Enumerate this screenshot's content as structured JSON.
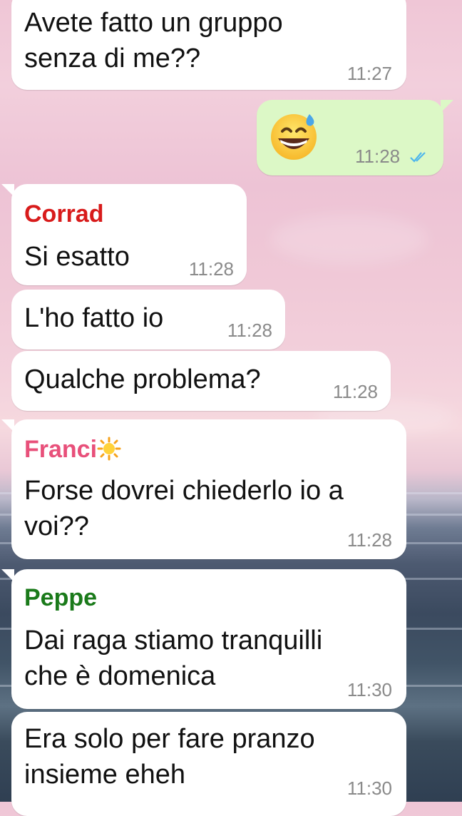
{
  "colors": {
    "incoming_bubble": "#ffffff",
    "outgoing_bubble": "#dcf8c6",
    "read_ticks": "#4fb6ec",
    "sender_corrad": "#d81b1b",
    "sender_franci": "#e8507a",
    "sender_peppe": "#1a7a1a"
  },
  "messages": [
    {
      "type": "incoming",
      "lines": [
        "Avete fatto un gruppo",
        "senza di me??"
      ],
      "time": "11:27"
    },
    {
      "type": "outgoing",
      "emoji": "grinning-face-with-sweat",
      "time": "11:28",
      "status": "read"
    },
    {
      "type": "incoming",
      "sender": "Corrad",
      "lines": [
        "Si esatto"
      ],
      "time": "11:28"
    },
    {
      "type": "incoming",
      "lines": [
        "L'ho fatto io"
      ],
      "time": "11:28"
    },
    {
      "type": "incoming",
      "lines": [
        "Qualche problema?"
      ],
      "time": "11:28"
    },
    {
      "type": "incoming",
      "sender": "Franci",
      "sender_emoji": "sun",
      "lines": [
        "Forse dovrei chiederlo io a",
        "voi??"
      ],
      "time": "11:28"
    },
    {
      "type": "incoming",
      "sender": "Peppe",
      "lines": [
        "Dai raga stiamo tranquilli",
        "che è domenica"
      ],
      "time": "11:30"
    },
    {
      "type": "incoming",
      "lines": [
        "Era solo per fare pranzo",
        "insieme eheh"
      ],
      "time": "11:30"
    }
  ]
}
